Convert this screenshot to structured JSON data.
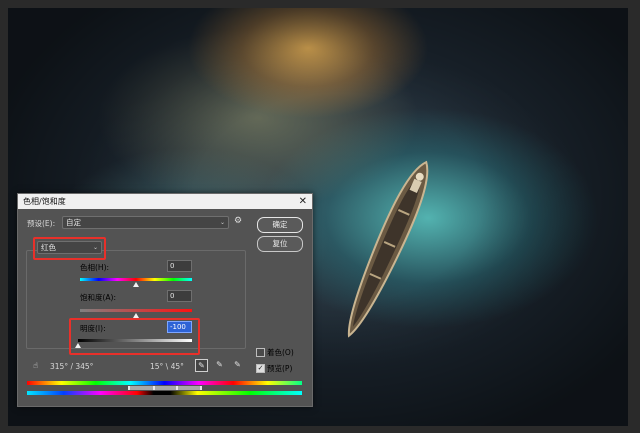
{
  "dialog": {
    "title": "色相/饱和度",
    "close_glyph": "✕",
    "preset_label": "预设(E):",
    "preset_value": "自定",
    "channel_value": "红色",
    "hue_label": "色相(H):",
    "hue_value": "0",
    "saturation_label": "饱和度(A):",
    "saturation_value": "0",
    "lightness_label": "明度(I):",
    "lightness_value": "-100",
    "ok_label": "确定",
    "reset_label": "复位",
    "range_left": "315° / 345°",
    "range_right": "15° \\ 45°",
    "colorize_label": "着色(O)",
    "preview_label": "预览(P)",
    "preview_checked": true,
    "colorize_checked": false
  },
  "slider_levels": {
    "hue": 0.5,
    "saturation": 0.5,
    "lightness": 0.0
  },
  "icons": [
    "gear-icon",
    "hand-target-icon",
    "eyedropper-icon",
    "eyedropper-plus-icon",
    "eyedropper-minus-icon"
  ],
  "highlight_color": "#e8302a"
}
